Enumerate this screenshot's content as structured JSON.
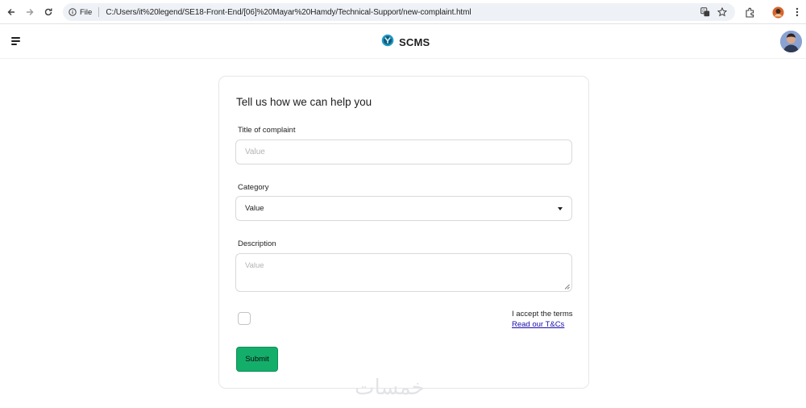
{
  "browser": {
    "file_label": "File",
    "url": "C:/Users/it%20legend/SE18-Front-End/[06]%20Mayar%20Hamdy/Technical-Support/new-complaint.html",
    "icons": [
      "back-icon",
      "forward-icon",
      "reload-icon",
      "info-icon",
      "translate-icon",
      "star-icon",
      "extensions-icon",
      "profile-icon",
      "menu-dots-icon"
    ]
  },
  "header": {
    "brand": "SCMS",
    "logo_color": "#1f9ac6",
    "icons": [
      "hamburger-menu-icon",
      "scms-logo-icon",
      "avatar"
    ]
  },
  "form": {
    "title": "Tell us how we can help you",
    "complaint_title": {
      "label": "Title of complaint",
      "placeholder": "Value"
    },
    "category": {
      "label": "Category",
      "selected": "Value"
    },
    "description": {
      "label": "Description",
      "placeholder": "Value"
    },
    "terms": {
      "text": "I accept the terms",
      "link": "Read our T&Cs",
      "checked": false
    },
    "submit_label": "Submit",
    "submit_color": "#14ae6b"
  },
  "watermark": "خمسات"
}
